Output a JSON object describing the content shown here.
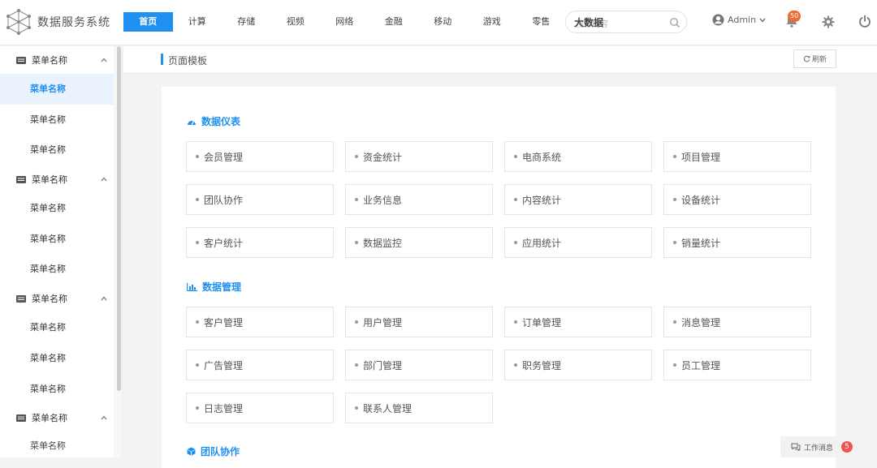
{
  "header": {
    "title": "数据服务系统",
    "nav": [
      {
        "label": "首页",
        "active": true
      },
      {
        "label": "计算"
      },
      {
        "label": "存储"
      },
      {
        "label": "视频"
      },
      {
        "label": "网络"
      },
      {
        "label": "金融"
      },
      {
        "label": "移动"
      },
      {
        "label": "游戏"
      },
      {
        "label": "零售"
      }
    ],
    "search": {
      "overlay": "大数据",
      "placeholder": "搜索内容"
    },
    "user": "Admin",
    "notifications": "50"
  },
  "sidebar": {
    "groups": [
      {
        "label": "菜单名称",
        "items": [
          "菜单名称",
          "菜单名称",
          "菜单名称"
        ]
      },
      {
        "label": "菜单名称",
        "items": [
          "菜单名称",
          "菜单名称",
          "菜单名称"
        ]
      },
      {
        "label": "菜单名称",
        "items": [
          "菜单名称",
          "菜单名称",
          "菜单名称"
        ]
      },
      {
        "label": "菜单名称",
        "items": [
          "菜单名称"
        ]
      }
    ],
    "active_item": "菜单名称"
  },
  "page": {
    "title": "页面模板",
    "refresh_label": "刷新"
  },
  "sections": [
    {
      "title": "数据仪表",
      "icon": "dashboard-icon",
      "tiles": [
        "会员管理",
        "资金统计",
        "电商系统",
        "项目管理",
        "团队协作",
        "业务信息",
        "内容统计",
        "设备统计",
        "客户统计",
        "数据监控",
        "应用统计",
        "销量统计"
      ]
    },
    {
      "title": "数据管理",
      "icon": "bar-chart-icon",
      "tiles": [
        "客户管理",
        "用户管理",
        "订单管理",
        "消息管理",
        "广告管理",
        "部门管理",
        "职务管理",
        "员工管理",
        "日志管理",
        "联系人管理"
      ]
    },
    {
      "title": "团队协作",
      "icon": "cube-icon",
      "tiles": []
    }
  ],
  "messages": {
    "label": "工作消息",
    "count": "5"
  },
  "colors": {
    "accent": "#1f8ff0",
    "badge": "#ef6b33",
    "message_badge": "#ef5350"
  }
}
